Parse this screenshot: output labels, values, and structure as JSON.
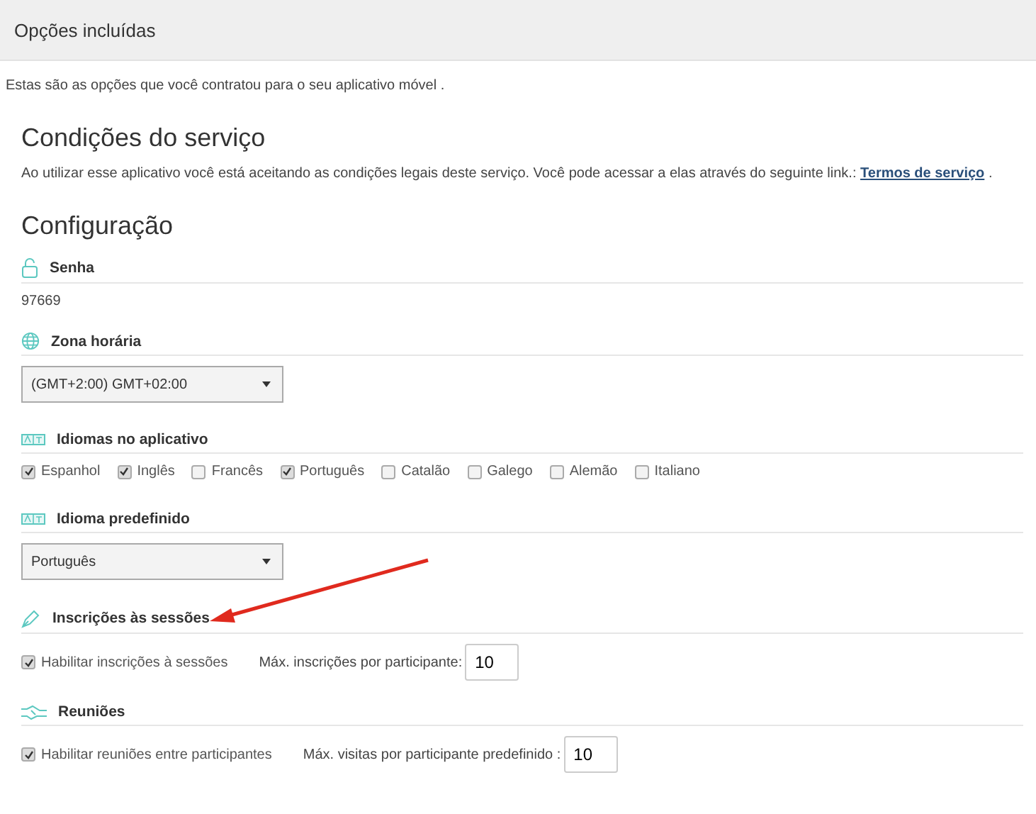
{
  "header": {
    "title": "Opções incluídas"
  },
  "intro": "Estas são as opções que você contratou para o seu aplicativo móvel .",
  "terms": {
    "heading": "Condições do serviço",
    "text": "Ao utilizar esse aplicativo você está aceitando as condições legais deste serviço. Você pode acessar a elas através do seguinte link.:",
    "link": "Termos de serviço",
    "after": "."
  },
  "config": {
    "heading": "Configuração",
    "sections": [
      {
        "kind": "value",
        "label": "Senha",
        "value": "97669"
      },
      {
        "kind": "select",
        "label": "Zona horária",
        "value": "(GMT+2:00) GMT+02:00"
      },
      {
        "kind": "checkboxes",
        "label": "Idiomas no aplicativo",
        "options": [
          {
            "label": "Espanhol",
            "checked": true
          },
          {
            "label": "Inglês",
            "checked": true
          },
          {
            "label": "Francês",
            "checked": false
          },
          {
            "label": "Português",
            "checked": true
          },
          {
            "label": "Catalão",
            "checked": false
          },
          {
            "label": "Galego",
            "checked": false
          },
          {
            "label": "Alemão",
            "checked": false
          },
          {
            "label": "Italiano",
            "checked": false
          }
        ]
      },
      {
        "kind": "select",
        "label": "Idioma predefinido",
        "value": "Português"
      },
      {
        "kind": "option",
        "label": "Inscrições às sessões",
        "check_label": "Habilitar inscrições à sessões",
        "checked": true,
        "field_label": "Máx. inscrições por participante:",
        "field_value": "10"
      },
      {
        "kind": "option",
        "label": "Reuniões",
        "check_label": "Habilitar reuniões entre participantes",
        "checked": true,
        "field_label": "Máx. visitas por participante predefinido :",
        "field_value": "10"
      }
    ]
  }
}
